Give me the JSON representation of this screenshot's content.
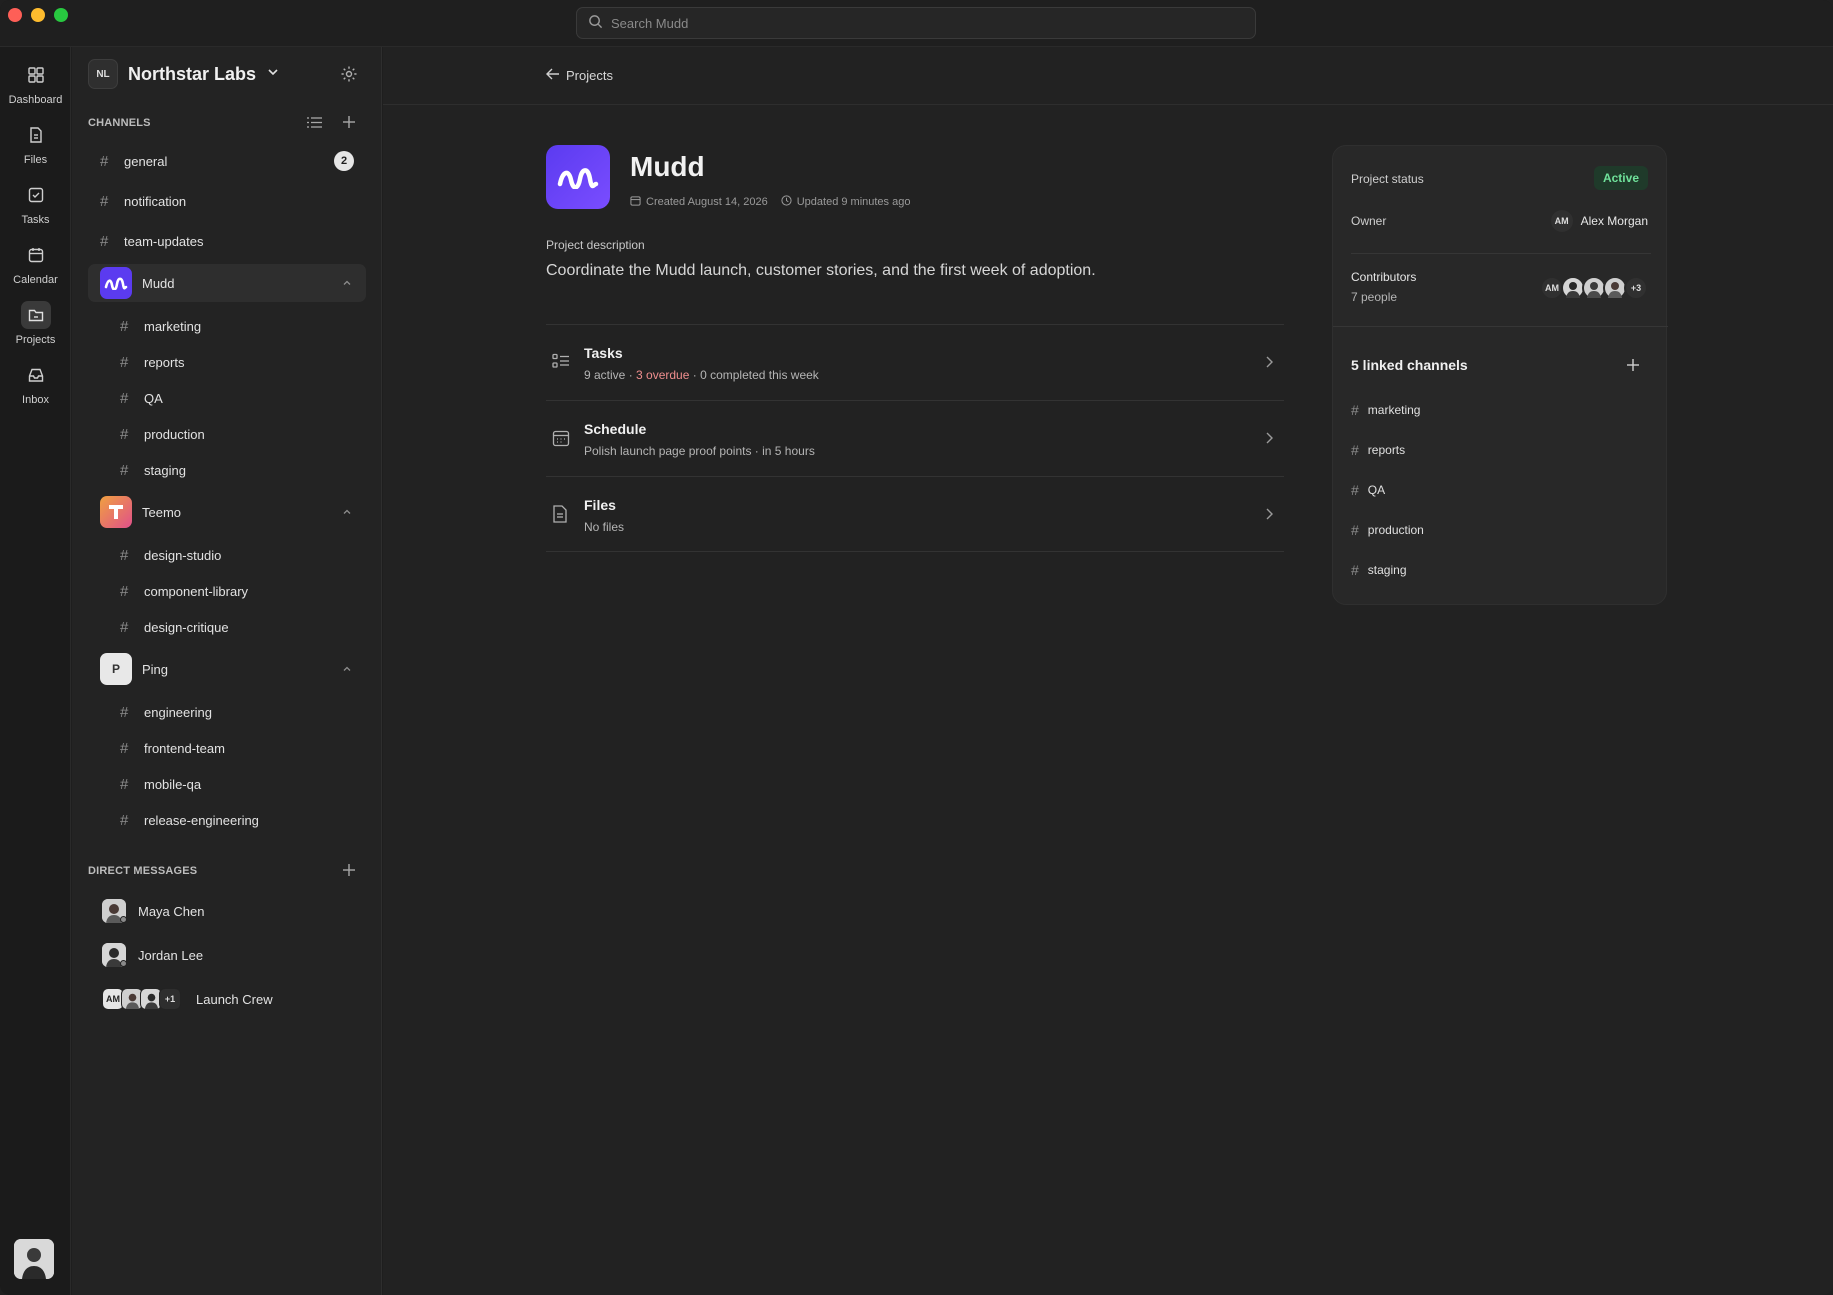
{
  "app": {
    "search_placeholder": "Search Mudd"
  },
  "rail": {
    "items": [
      {
        "label": "Dashboard",
        "icon": "dashboard-icon"
      },
      {
        "label": "Files",
        "icon": "file-icon"
      },
      {
        "label": "Tasks",
        "icon": "tasks-icon"
      },
      {
        "label": "Calendar",
        "icon": "calendar-icon"
      },
      {
        "label": "Projects",
        "icon": "projects-icon",
        "active": true
      },
      {
        "label": "Inbox",
        "icon": "inbox-icon"
      }
    ]
  },
  "sidebar": {
    "workspace_initials": "NL",
    "workspace_name": "Northstar Labs",
    "channels_title": "CHANNELS",
    "channels": [
      {
        "name": "general",
        "unread": "2"
      },
      {
        "name": "notification"
      },
      {
        "name": "team-updates"
      }
    ],
    "groups": [
      {
        "name": "Mudd",
        "logo": "M",
        "color": "#5b3bf0",
        "channels": [
          "marketing",
          "reports",
          "QA",
          "production",
          "staging"
        ]
      },
      {
        "name": "Teemo",
        "logo": "T",
        "color": "#e9754f",
        "channels": [
          "design-studio",
          "component-library",
          "design-critique"
        ]
      },
      {
        "name": "Ping",
        "logo": "P",
        "color": "#e8e8e8",
        "channels": [
          "engineering",
          "frontend-team",
          "mobile-qa",
          "release-engineering"
        ]
      }
    ],
    "dm_title": "DIRECT MESSAGES",
    "dms": [
      {
        "name": "Maya Chen"
      },
      {
        "name": "Jordan Lee"
      },
      {
        "name": "Launch Crew",
        "initials": "AM",
        "extra": "+1"
      }
    ]
  },
  "main": {
    "back_label": "Projects",
    "project_name": "Mudd",
    "created": "Created August 14, 2026",
    "updated": "Updated 9 minutes ago",
    "description_label": "Project description",
    "description": "Coordinate the Mudd launch, customer stories, and the first week of adoption.",
    "rows": {
      "tasks": {
        "title": "Tasks",
        "active": "9 active · ",
        "overdue": "3 overdue",
        "rest": " · 0 completed this week"
      },
      "schedule": {
        "title": "Schedule",
        "sub": "Polish launch page proof points · in 5 hours"
      },
      "files": {
        "title": "Files",
        "sub": "No files"
      }
    }
  },
  "card": {
    "status_label": "Project status",
    "status_value": "Active",
    "owner_label": "Owner",
    "owner_initials": "AM",
    "owner_name": "Alex Morgan",
    "contributors_label": "Contributors",
    "contributors_count": "7 people",
    "contributors_initials": "AM",
    "contributors_extra": "+3",
    "linked_title": "5 linked channels",
    "linked": [
      "marketing",
      "reports",
      "QA",
      "production",
      "staging"
    ]
  },
  "colors": {
    "accent": "#5b3bf0",
    "status_active": "#6fe19a",
    "overdue": "#ef8e8e"
  }
}
